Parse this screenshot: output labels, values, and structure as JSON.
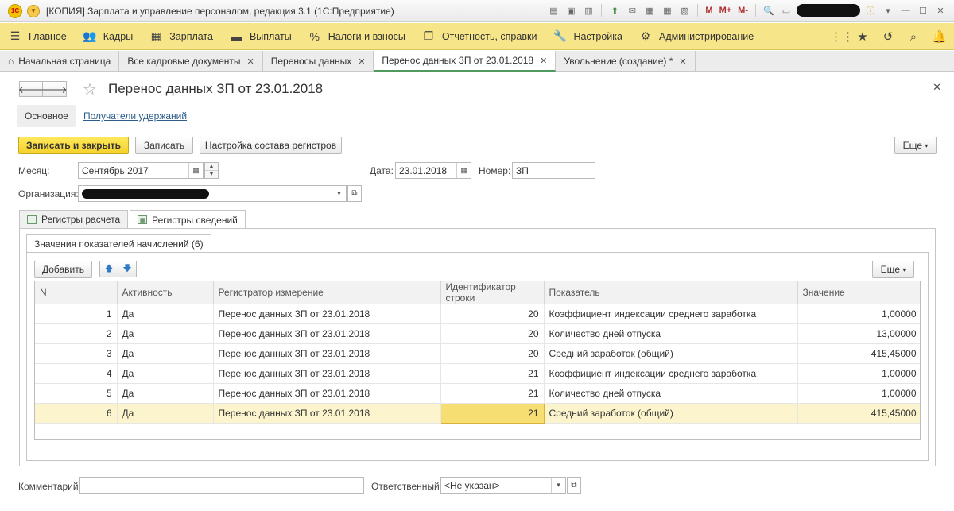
{
  "window": {
    "title": "[КОПИЯ] Зарплата и управление персоналом, редакция 3.1  (1С:Предприятие)",
    "logo_text": "1С",
    "tools": [
      "M",
      "M+",
      "M-"
    ]
  },
  "main_menu": {
    "items": [
      {
        "icon": "hamburger-icon",
        "label": "Главное"
      },
      {
        "icon": "people-icon",
        "label": "Кадры"
      },
      {
        "icon": "calculator-icon",
        "label": "Зарплата"
      },
      {
        "icon": "wallet-icon",
        "label": "Выплаты"
      },
      {
        "icon": "percent-icon",
        "label": "Налоги и взносы"
      },
      {
        "icon": "reports-icon",
        "label": "Отчетность, справки"
      },
      {
        "icon": "wrench-icon",
        "label": "Настройка"
      },
      {
        "icon": "gear-icon",
        "label": "Администрирование"
      }
    ]
  },
  "tabs": [
    {
      "label": "Начальная страница"
    },
    {
      "label": "Все кадровые документы"
    },
    {
      "label": "Переносы данных"
    },
    {
      "label": "Перенос данных ЗП от 23.01.2018"
    },
    {
      "label": "Увольнение (создание) *"
    }
  ],
  "form": {
    "title": "Перенос данных ЗП от 23.01.2018",
    "panel_main": "Основное",
    "panel_link": "Получатели удержаний",
    "buttons": {
      "save_close": "Записать и закрыть",
      "save": "Записать",
      "registers_setup": "Настройка состава регистров",
      "more": "Еще"
    },
    "month_label": "Месяц:",
    "month_value": "Сентябрь 2017",
    "date_label": "Дата:",
    "date_value": "23.01.2018",
    "number_label": "Номер:",
    "number_value": "ЗП",
    "org_label": "Организация:",
    "comment_label": "Комментарий:",
    "comment_value": "",
    "responsible_label": "Ответственный:",
    "responsible_value": "<Не указан>"
  },
  "page_tabs": [
    {
      "label": "Регистры расчета"
    },
    {
      "label": "Регистры сведений"
    }
  ],
  "sub_tab": {
    "label": "Значения показателей начислений (6)"
  },
  "table": {
    "add_label": "Добавить",
    "more_label": "Еще",
    "columns": [
      "N",
      "Активность",
      "Регистратор измерение",
      "Идентификатор строки",
      "Показатель",
      "Значение"
    ],
    "rows": [
      {
        "n": "1",
        "active": "Да",
        "registrar": "Перенос данных ЗП от 23.01.2018",
        "row_id": "20",
        "indicator": "Коэффициент индексации среднего заработка",
        "value": "1,00000"
      },
      {
        "n": "2",
        "active": "Да",
        "registrar": "Перенос данных ЗП от 23.01.2018",
        "row_id": "20",
        "indicator": "Количество дней отпуска",
        "value": "13,00000"
      },
      {
        "n": "3",
        "active": "Да",
        "registrar": "Перенос данных ЗП от 23.01.2018",
        "row_id": "20",
        "indicator": "Средний заработок (общий)",
        "value": "415,45000"
      },
      {
        "n": "4",
        "active": "Да",
        "registrar": "Перенос данных ЗП от 23.01.2018",
        "row_id": "21",
        "indicator": "Коэффициент индексации среднего заработка",
        "value": "1,00000"
      },
      {
        "n": "5",
        "active": "Да",
        "registrar": "Перенос данных ЗП от 23.01.2018",
        "row_id": "21",
        "indicator": "Количество дней отпуска",
        "value": "1,00000"
      },
      {
        "n": "6",
        "active": "Да",
        "registrar": "Перенос данных ЗП от 23.01.2018",
        "row_id": "21",
        "indicator": "Средний заработок (общий)",
        "value": "415,45000"
      }
    ]
  },
  "colors": {
    "menu_bg": "#f7e58a",
    "primary_button": "#f5d12c",
    "selected_row": "#fbf4cc",
    "active_tab_underline": "#4f9a5f"
  }
}
